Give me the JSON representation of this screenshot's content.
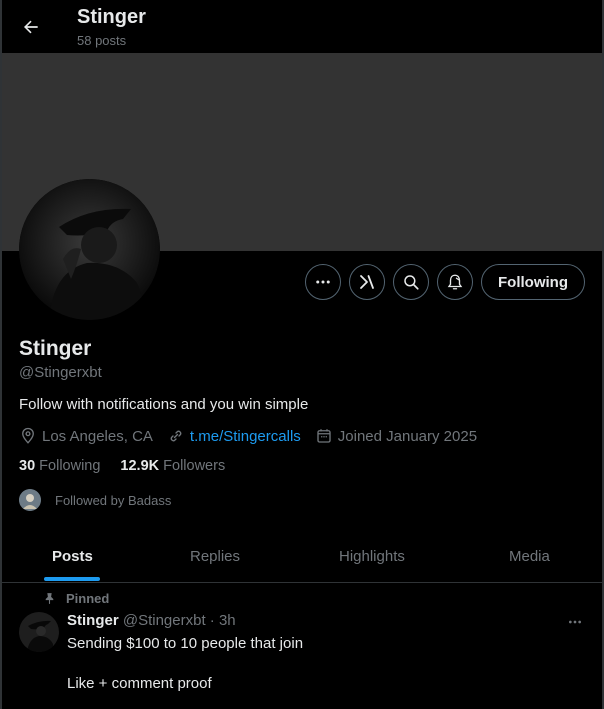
{
  "header": {
    "title": "Stinger",
    "subtitle": "58 posts"
  },
  "profile": {
    "name": "Stinger",
    "handle": "@Stingerxbt",
    "bio": "Follow with notifications and you win simple",
    "location": "Los Angeles, CA",
    "link": "t.me/Stingercalls",
    "joined": "Joined January 2025",
    "following_count": "30",
    "following_label": "Following",
    "followers_count": "12.9K",
    "followers_label": "Followers",
    "followed_by": "Followed by Badass"
  },
  "actions": {
    "following_button": "Following"
  },
  "tabs": [
    {
      "label": "Posts",
      "active": true
    },
    {
      "label": "Replies",
      "active": false
    },
    {
      "label": "Highlights",
      "active": false
    },
    {
      "label": "Media",
      "active": false
    }
  ],
  "post": {
    "pinned_label": "Pinned",
    "author": "Stinger",
    "meta": "@Stingerxbt · 3h",
    "line1": "Sending $100 to 10 people that join",
    "line2": "Like + comment proof"
  },
  "colors": {
    "accent": "#1d9bf0",
    "background": "#000000",
    "banner": "#333333",
    "muted": "#71767b"
  }
}
